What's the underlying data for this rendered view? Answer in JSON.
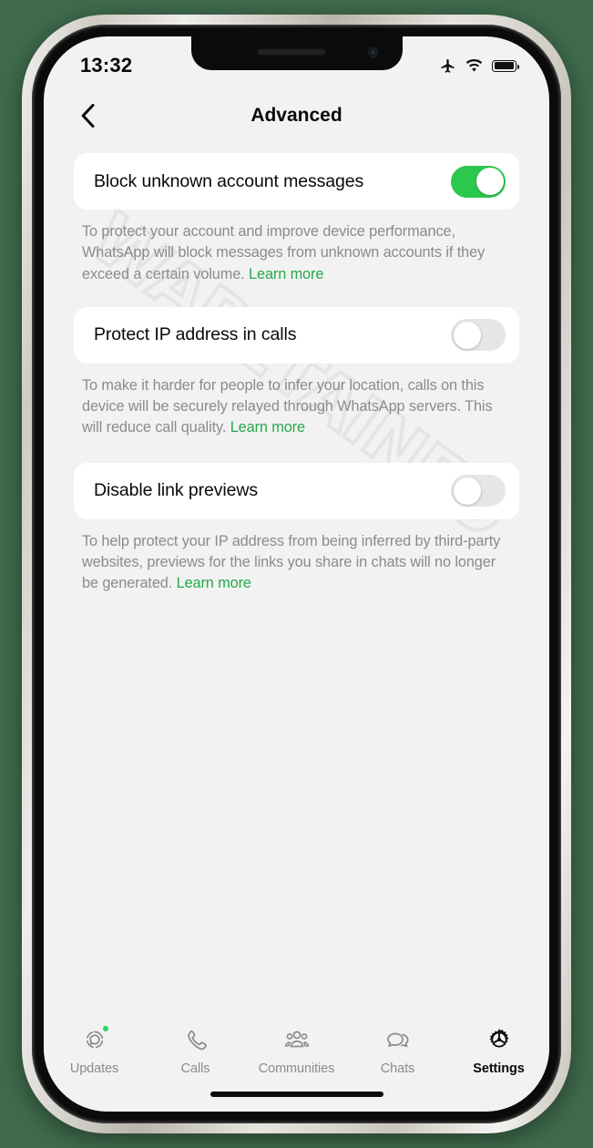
{
  "status_bar": {
    "time": "13:32",
    "icons": [
      "airplane-mode-icon",
      "wifi-icon",
      "battery-icon"
    ],
    "battery_level": 100
  },
  "nav": {
    "back_icon": "chevron-left-icon",
    "title": "Advanced"
  },
  "watermark": {
    "text": "WABETAINFO"
  },
  "settings": [
    {
      "label": "Block unknown account messages",
      "toggle_state": "on",
      "description": "To protect your account and improve device performance, WhatsApp will block messages from unknown accounts if they exceed a certain volume. ",
      "link_text": "Learn more",
      "link_inline": false
    },
    {
      "label": "Protect IP address in calls",
      "toggle_state": "off",
      "description": "To make it harder for people to infer your location, calls on this device will be securely relayed through WhatsApp servers. This will reduce call quality. ",
      "link_text": "Learn more",
      "link_inline": true
    },
    {
      "label": "Disable link previews",
      "toggle_state": "off",
      "description": "To help protect your IP address from being inferred by third-party websites, previews for the links you share in chats will no longer be generated. ",
      "link_text": "Learn more",
      "link_inline": true
    }
  ],
  "tabs": [
    {
      "label": "Updates",
      "icon": "status-updates-icon",
      "active": false,
      "badge": true
    },
    {
      "label": "Calls",
      "icon": "phone-icon",
      "active": false,
      "badge": false
    },
    {
      "label": "Communities",
      "icon": "communities-icon",
      "active": false,
      "badge": false
    },
    {
      "label": "Chats",
      "icon": "chat-bubbles-icon",
      "active": false,
      "badge": false
    },
    {
      "label": "Settings",
      "icon": "gear-icon",
      "active": true,
      "badge": false
    }
  ],
  "colors": {
    "toggle_on": "#2cc84e",
    "toggle_off": "#e6e6e6",
    "link": "#26a84a",
    "badge": "#25d366",
    "screen_bg": "#f2f2f2",
    "card_bg": "#ffffff",
    "desc_text": "#8b8b8f",
    "page_bg": "#3f6b4c"
  }
}
